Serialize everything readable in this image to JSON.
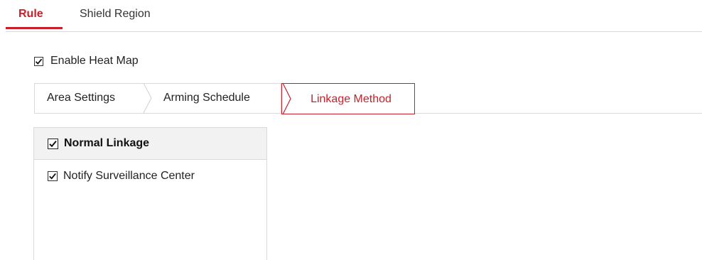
{
  "top_tabs": {
    "rule": "Rule",
    "shield_region": "Shield Region"
  },
  "enable_heat_map": {
    "label": "Enable Heat Map",
    "checked": true
  },
  "steps": {
    "area_settings": "Area Settings",
    "arming_schedule": "Arming Schedule",
    "linkage_method": "Linkage Method",
    "active": "linkage_method"
  },
  "linkage": {
    "header": "Normal Linkage",
    "items": [
      {
        "label": "Notify Surveillance Center",
        "checked": true
      }
    ]
  },
  "colors": {
    "accent": "#c8202a",
    "border": "#d9d9d9",
    "panel_header_bg": "#f2f2f2"
  }
}
